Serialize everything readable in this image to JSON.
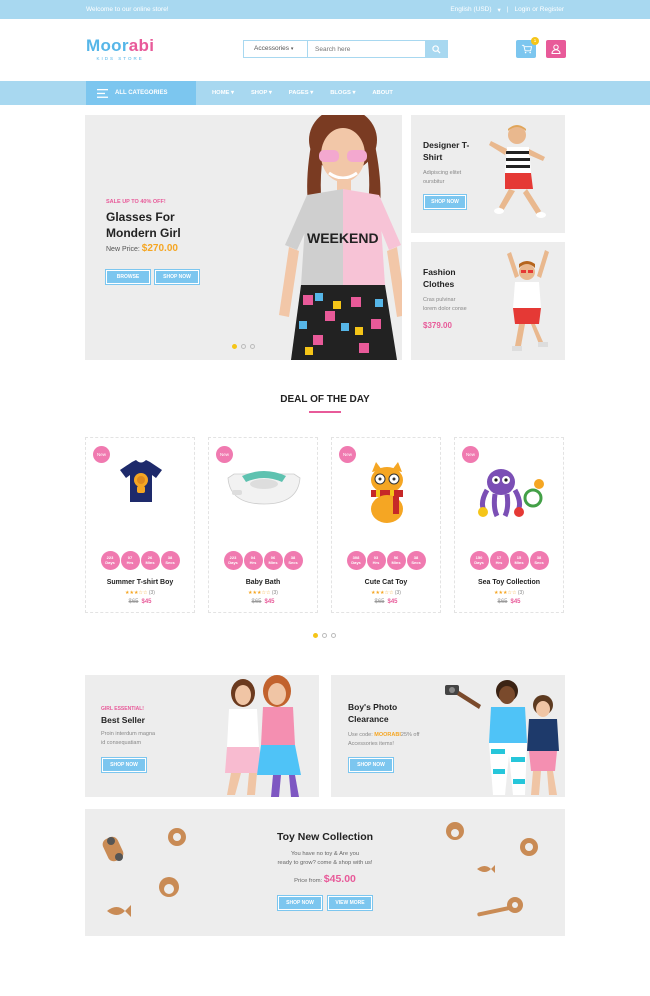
{
  "topbar": {
    "welcome": "Welcome to our online store!",
    "language": "English (USD)",
    "login": "Login or Register"
  },
  "logo": {
    "name": "Moorabi",
    "tagline": "KIDS STORE"
  },
  "search": {
    "category": "Accessories",
    "placeholder": "Search here"
  },
  "cart": {
    "count": "1"
  },
  "nav": {
    "all_categories": "ALL CATEGORIES",
    "menu": [
      "HOME",
      "SHOP",
      "PAGES",
      "BLOGS",
      "ABOUT"
    ]
  },
  "hero": {
    "tag": "SALE UP TO 40% OFF!",
    "title_line1": "Glasses For",
    "title_line2": "Mondern Girl",
    "price_label": "New Price:",
    "price": "$270.00",
    "btn_browse": "BROWSE",
    "btn_shop": "SHOP NOW",
    "shirt_text": "WEEKEND"
  },
  "side1": {
    "title_line1": "Designer T-",
    "title_line2": "Shirt",
    "desc_line1": "Adipiscing elitet",
    "desc_line2": "oursbitur",
    "btn": "SHOP NOW"
  },
  "side2": {
    "title_line1": "Fashion",
    "title_line2": "Clothes",
    "desc_line1": "Cras pulvinar",
    "desc_line2": "lorem dolor conse",
    "price": "$379.00"
  },
  "deal": {
    "title": "DEAL OF THE DAY"
  },
  "products": [
    {
      "badge": "New",
      "name": "Summer T-shirt Boy",
      "count": "(3)",
      "old": "$65",
      "new": "$45",
      "countdown": [
        {
          "v": "223",
          "u": "Days"
        },
        {
          "v": "07",
          "u": "Hrs"
        },
        {
          "v": "26",
          "u": "Mins"
        },
        {
          "v": "38",
          "u": "Secs"
        }
      ]
    },
    {
      "badge": "New",
      "name": "Baby Bath",
      "count": "(3)",
      "old": "$65",
      "new": "$45",
      "countdown": [
        {
          "v": "223",
          "u": "Days"
        },
        {
          "v": "04",
          "u": "Hrs"
        },
        {
          "v": "06",
          "u": "Mins"
        },
        {
          "v": "38",
          "u": "Secs"
        }
      ]
    },
    {
      "badge": "New",
      "name": "Cute Cat Toy",
      "count": "(3)",
      "old": "$65",
      "new": "$45",
      "countdown": [
        {
          "v": "308",
          "u": "Days"
        },
        {
          "v": "03",
          "u": "Hrs"
        },
        {
          "v": "56",
          "u": "Mins"
        },
        {
          "v": "38",
          "u": "Secs"
        }
      ]
    },
    {
      "badge": "New",
      "name": "Sea Toy Collection",
      "count": "(3)",
      "old": "$65",
      "new": "$45",
      "countdown": [
        {
          "v": "150",
          "u": "Days"
        },
        {
          "v": "17",
          "u": "Hrs"
        },
        {
          "v": "15",
          "u": "Mins"
        },
        {
          "v": "38",
          "u": "Secs"
        }
      ]
    }
  ],
  "banner1": {
    "tag": "GIRL ESSENTIAL!",
    "title": "Best Seller",
    "desc_line1": "Proin interdum magna",
    "desc_line2": "id consequatiam",
    "btn": "SHOP NOW"
  },
  "banner2": {
    "title_line1": "Boy's Photo",
    "title_line2": "Clearance",
    "desc_pre": "Use code:",
    "code": "MOORABI",
    "desc_post": "25% off",
    "desc_line2": "Accessories items!",
    "btn": "SHOP NOW"
  },
  "toy": {
    "title": "Toy New Collection",
    "desc_line1": "You have no toy & Are you",
    "desc_line2": "ready to grow? come & shop with us!",
    "price_label": "Price from:",
    "price": "$45.00",
    "btn_shop": "SHOP NOW",
    "btn_view": "VIEW MORE"
  },
  "colors": {
    "primary": "#a8d8f0",
    "accent": "#e85a99",
    "star": "#f5a623",
    "dot_active": "#f5c518"
  }
}
